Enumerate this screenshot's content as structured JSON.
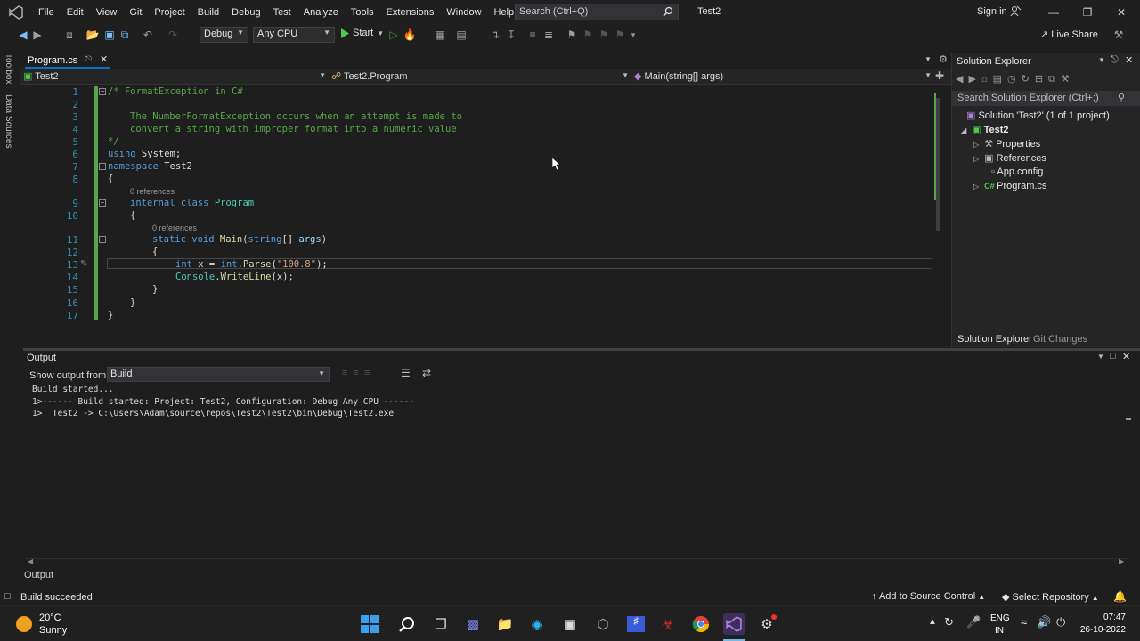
{
  "menubar": {
    "items": [
      "File",
      "Edit",
      "View",
      "Git",
      "Project",
      "Build",
      "Debug",
      "Test",
      "Analyze",
      "Tools",
      "Extensions",
      "Window",
      "Help"
    ],
    "search_placeholder": "Search (Ctrl+Q)",
    "solution_name": "Test2",
    "signin": "Sign in"
  },
  "toolbar": {
    "configuration": "Debug",
    "platform": "Any CPU",
    "start_label": "Start",
    "live_share": "Live Share"
  },
  "left_tabs": [
    "Toolbox",
    "Data Sources"
  ],
  "editor": {
    "tab_title": "Program.cs",
    "nav_project": "Test2",
    "nav_class": "Test2.Program",
    "nav_member": "Main(string[] args)",
    "line_numbers": [
      "1",
      "2",
      "3",
      "4",
      "5",
      "6",
      "7",
      "8",
      "9",
      "10",
      "11",
      "12",
      "13",
      "14",
      "15",
      "16",
      "17"
    ],
    "codelens_class": "0 references",
    "codelens_method": "0 references"
  },
  "code": {
    "l1": "/* FormatException in C#",
    "l3": "The NumberFormatException occurs when an attempt is made to",
    "l4": "convert a string with improper format into a numeric value",
    "l5": "*/",
    "l6_kw": "using",
    "l6_rest": " System;",
    "l7_kw": "namespace",
    "l7_rest": " Test2",
    "l8": "{",
    "l9_kw": "internal class",
    "l9_ty": "Program",
    "l10": "{",
    "l11_kw": "static void",
    "l11_m": "Main",
    "l11_p1": "(",
    "l11_kw2": "string",
    "l11_p2": "[] ",
    "l11_param": "args",
    "l11_p3": ")",
    "l12": "{",
    "l13_kw": "int",
    "l13_a": " x = ",
    "l13_kw2": "int",
    "l13_b": ".",
    "l13_m": "Parse",
    "l13_c": "(",
    "l13_str": "\"100.8\"",
    "l13_d": ");",
    "l14_ty": "Console",
    "l14_a": ".",
    "l14_m": "WriteLine",
    "l14_b": "(x);",
    "l15": "}",
    "l16": "}",
    "l17": "}"
  },
  "solution_explorer": {
    "title": "Solution Explorer",
    "search_placeholder": "Search Solution Explorer (Ctrl+;)",
    "solution_label": "Solution 'Test2' (1 of 1 project)",
    "project": "Test2",
    "items": [
      "Properties",
      "References",
      "App.config",
      "Program.cs"
    ],
    "tab_solution_explorer": "Solution Explorer",
    "tab_git_changes": "Git Changes"
  },
  "output": {
    "title": "Output",
    "show_from_label": "Show output from:",
    "source": "Build",
    "lines": [
      "Build started...",
      "1>------ Build started: Project: Test2, Configuration: Debug Any CPU ------",
      "1>  Test2 -> C:\\Users\\Adam\\source\\repos\\Test2\\Test2\\bin\\Debug\\Test2.exe"
    ],
    "bottom_tab": "Output"
  },
  "statusbar": {
    "status": "Build succeeded",
    "source_control": "Add to Source Control",
    "repository": "Select Repository"
  },
  "taskbar": {
    "temperature": "20°C",
    "condition": "Sunny",
    "language_top": "ENG",
    "language_bottom": "IN",
    "time": "07:47",
    "date": "26-10-2022"
  },
  "colors": {
    "accent": "#0e70c0",
    "comment": "#57a64a",
    "keyword": "#569cd6",
    "type": "#4ec9b0",
    "string": "#d69d85"
  }
}
